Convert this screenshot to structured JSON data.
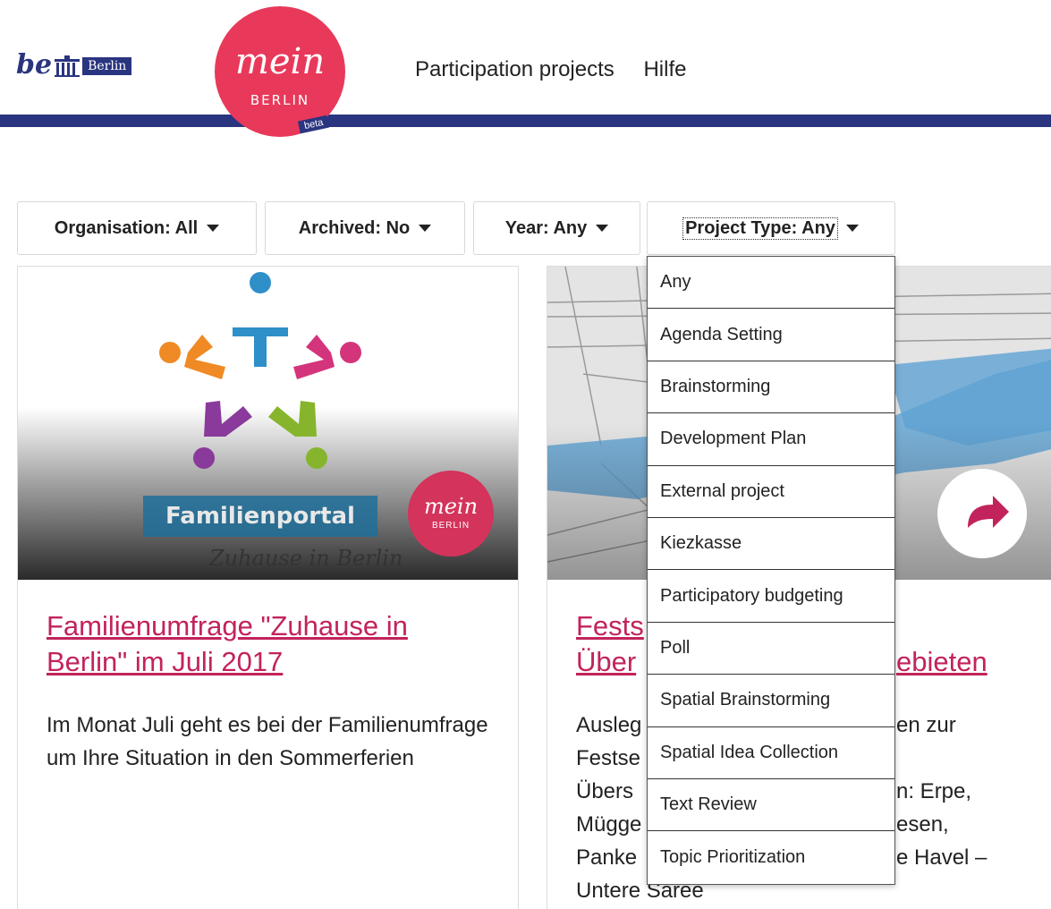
{
  "header": {
    "be_logo_text": "be",
    "berlin_badge": "Berlin",
    "mein_logo_word": "mein",
    "mein_logo_city": "BERLIN",
    "mein_logo_beta": "beta",
    "nav": [
      {
        "label": "Participation projects"
      },
      {
        "label": "Hilfe"
      }
    ]
  },
  "filters": {
    "organisation": "Organisation: All",
    "archived": "Archived: No",
    "year": "Year: Any",
    "project_type": "Project Type: Any"
  },
  "project_type_options": [
    "Any",
    "Agenda Setting",
    "Brainstorming",
    "Development Plan",
    "External project",
    "Kiezkasse",
    "Participatory budgeting",
    "Poll",
    "Spatial Brainstorming",
    "Spatial Idea Collection",
    "Text Review",
    "Topic Prioritization"
  ],
  "cards": [
    {
      "image_banner": "Familienportal",
      "image_script": "Zuhause in Berlin",
      "image_badge_word": "mein",
      "image_badge_city": "BERLIN",
      "title": "Familienumfrage \"Zuhause in Berlin\" im Juli 2017",
      "description": "Im Monat Juli geht es bei der Familienumfrage um Ihre Situation in den Sommerferien"
    },
    {
      "title_visible_line1": "Fests",
      "title_visible_line2a": "Über",
      "title_visible_line2b": "ebieten",
      "desc_left": [
        "Ausleg",
        "Festse",
        "Übers",
        "Mügge",
        "Panke",
        "Untere Saree"
      ],
      "desc_right": [
        "en zur",
        "",
        "n: Erpe,",
        "esen,",
        "e Havel –",
        ""
      ]
    }
  ],
  "colors": {
    "brand_blue": "#2a3580",
    "mein_red": "#e8395a",
    "link_red": "#c2235c"
  }
}
